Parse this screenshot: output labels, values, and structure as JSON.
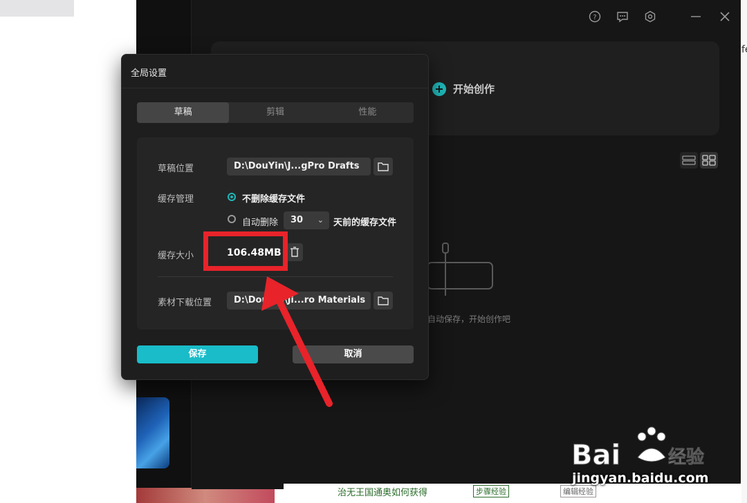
{
  "app": {
    "start_label": "开始创作",
    "empty_hint": "自动保存，开始创作吧",
    "topbar_icons": [
      "help-icon",
      "feedback-icon",
      "settings-icon",
      "minimize-icon",
      "close-icon"
    ]
  },
  "dialog": {
    "title": "全局设置",
    "tabs": [
      {
        "label": "草稿",
        "active": true
      },
      {
        "label": "剪辑",
        "active": false
      },
      {
        "label": "性能",
        "active": false
      }
    ],
    "draft_location": {
      "label": "草稿位置",
      "value": "D:\\DouYin\\J...gPro Drafts"
    },
    "cache_management": {
      "label": "缓存管理",
      "option_keep": "不删除缓存文件",
      "option_auto": "自动删除",
      "days_value": "30",
      "days_suffix": "天前的缓存文件"
    },
    "cache_size": {
      "label": "缓存大小",
      "value": "106.48MB"
    },
    "material_location": {
      "label": "素材下载位置",
      "value": "D:\\DouYin\\Ji...ro Materials"
    },
    "save_label": "保存",
    "cancel_label": "取消"
  },
  "background_page": {
    "right_fragment": "fe",
    "bottom_fragment": "治无王国通奥如何获得",
    "bottom_tags": [
      "步骤经验",
      "编辑经验"
    ]
  },
  "watermark": {
    "url": "jingyan.baidu.com"
  },
  "colors": {
    "accent": "#19bcc8",
    "annotation_red": "#e8232a",
    "dialog_bg": "#1e1e1e"
  }
}
